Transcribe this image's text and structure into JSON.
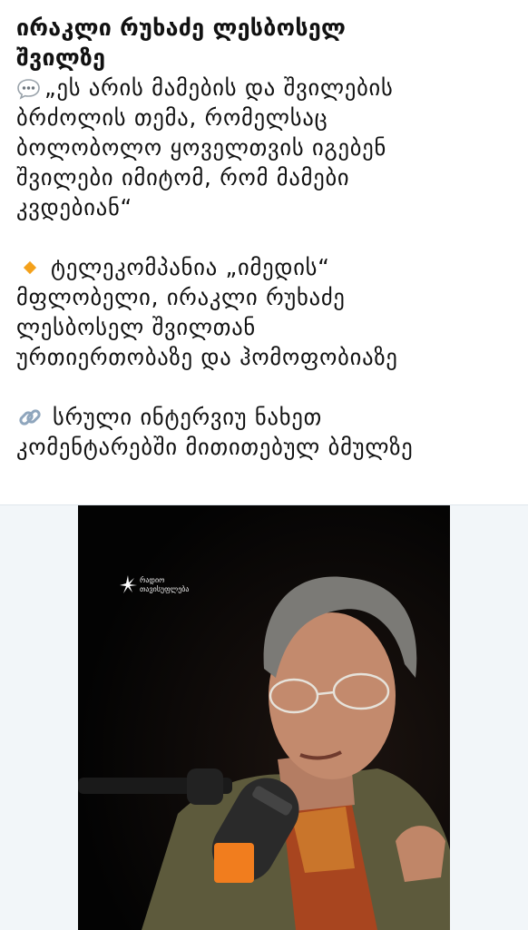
{
  "post": {
    "title_lines": [
      "ირაკლი რუხაძე ლესბოსელ",
      "შვილზე"
    ],
    "quote_lines": [
      "„ეს არის მამების და შვილების",
      "ბრძოლის თემა, რომელსაც",
      "ბოლობოლო ყოველთვის იგებენ",
      "შვილები იმიტომ, რომ მამები",
      "კვდებიან“"
    ],
    "info_lines": [
      "ტელეკომპანია „იმედის“",
      "მფლობელი, ირაკლი რუხაძე",
      "ლესბოსელ შვილთან",
      "ურთიერთობაზე და ჰომოფობიაზე"
    ],
    "link_lines": [
      "სრული ინტერვიუ ნახეთ",
      "კომენტარებში მითითებულ ბმულზე"
    ]
  },
  "icons": {
    "speech": "speech-bubble-emoji",
    "bullet": "orange-diamond-emoji",
    "link": "link-emoji"
  },
  "media": {
    "logo_lines": [
      "რადიო",
      "თავისუფლება"
    ]
  },
  "colors": {
    "text": "#111111",
    "accent_orange": "#f4a11b",
    "video_background": "#050505"
  }
}
